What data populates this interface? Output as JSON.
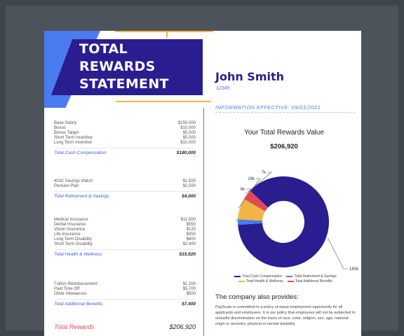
{
  "header": {
    "title_lines": [
      "TOTAL",
      "REWARDS",
      "STATEMENT"
    ]
  },
  "employee": {
    "name": "John Smith",
    "id": "12345",
    "effective": "INFORMATION EFFECTIVE: 09/01/2021"
  },
  "sections": [
    {
      "items": [
        {
          "label": "Base Salary",
          "value": "$150,000"
        },
        {
          "label": "Bonus",
          "value": "$10,000"
        },
        {
          "label": "Bonus Target",
          "value": "$5,000"
        },
        {
          "label": "Short Term Incentive",
          "value": "$5,000"
        },
        {
          "label": "Long Term Incentive",
          "value": "$10,000"
        }
      ],
      "total_label": "Total Cash Compensation",
      "total_value": "$180,000"
    },
    {
      "items": [
        {
          "label": "401K Savings Match",
          "value": "$1,500"
        },
        {
          "label": "Pension Plan",
          "value": "$2,500"
        }
      ],
      "total_label": "Total Retirement & Savings",
      "total_value": "$4,000"
    },
    {
      "items": [
        {
          "label": "Medical Insurance",
          "value": "$11,500"
        },
        {
          "label": "Dental Insurance",
          "value": "$550"
        },
        {
          "label": "Vision Insurance",
          "value": "$120"
        },
        {
          "label": "Life Insurance",
          "value": "$350"
        },
        {
          "label": "Long Term Disability",
          "value": "$600"
        },
        {
          "label": "Short Term Disability",
          "value": "$2,400"
        }
      ],
      "total_label": "Total Health & Wellness",
      "total_value": "$15,520"
    },
    {
      "items": [
        {
          "label": "Tuition Reimbursement",
          "value": "$1,200"
        },
        {
          "label": "Paid Time Off",
          "value": "$5,700"
        },
        {
          "label": "Other Allowances",
          "value": "$500"
        }
      ],
      "total_label": "Total Additional Benefits",
      "total_value": "$7,400"
    }
  ],
  "grand_total": {
    "label": "Total Rewards",
    "value": "$206,920"
  },
  "chart": {
    "title": "Your Total Rewards Value",
    "value": "$206,920"
  },
  "chart_data": {
    "type": "pie",
    "donut": true,
    "categories": [
      "Total Cash Compensation",
      "Total Retirement & Savings",
      "Total Health & Wellness",
      "Total Additional Benefits"
    ],
    "values": [
      180000,
      4000,
      15520,
      7400
    ],
    "data_labels": [
      "180k",
      "4k",
      "16k",
      "7k"
    ],
    "colors": [
      "#2a1d8f",
      "#4a7cf0",
      "#f2b544",
      "#e04a58"
    ],
    "title": "Your Total Rewards Value",
    "legend_position": "bottom"
  },
  "legend_rows": [
    [
      {
        "label": "Total Cash Compensation",
        "color": "#2a1d8f"
      },
      {
        "label": "Total Retirement & Savings",
        "color": "#4a7cf0"
      }
    ],
    [
      {
        "label": "Total Health & Wellness",
        "color": "#f2b544"
      },
      {
        "label": "Total Additional Benefits",
        "color": "#e04a58"
      }
    ]
  ],
  "also": {
    "title": "The company also provides:",
    "text": "PayScale is committed to a policy of equal employment opportunity for all applicants and employees. It is our policy that employees will not be subjected to unlawful discrimination on the basis of race, color, religion, sex, age, national origin or ancestry, physical or mental disability"
  }
}
